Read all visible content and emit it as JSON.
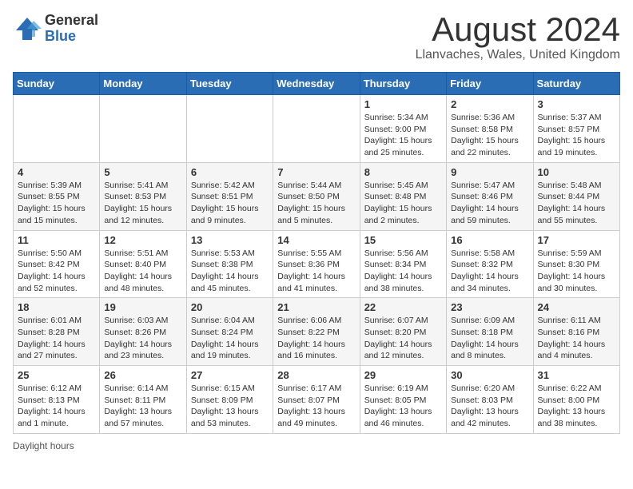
{
  "header": {
    "logo_general": "General",
    "logo_blue": "Blue",
    "month_title": "August 2024",
    "location": "Llanvaches, Wales, United Kingdom"
  },
  "weekdays": [
    "Sunday",
    "Monday",
    "Tuesday",
    "Wednesday",
    "Thursday",
    "Friday",
    "Saturday"
  ],
  "footer": {
    "daylight_label": "Daylight hours"
  },
  "weeks": [
    [
      {
        "day": "",
        "info": ""
      },
      {
        "day": "",
        "info": ""
      },
      {
        "day": "",
        "info": ""
      },
      {
        "day": "",
        "info": ""
      },
      {
        "day": "1",
        "info": "Sunrise: 5:34 AM\nSunset: 9:00 PM\nDaylight: 15 hours\nand 25 minutes."
      },
      {
        "day": "2",
        "info": "Sunrise: 5:36 AM\nSunset: 8:58 PM\nDaylight: 15 hours\nand 22 minutes."
      },
      {
        "day": "3",
        "info": "Sunrise: 5:37 AM\nSunset: 8:57 PM\nDaylight: 15 hours\nand 19 minutes."
      }
    ],
    [
      {
        "day": "4",
        "info": "Sunrise: 5:39 AM\nSunset: 8:55 PM\nDaylight: 15 hours\nand 15 minutes."
      },
      {
        "day": "5",
        "info": "Sunrise: 5:41 AM\nSunset: 8:53 PM\nDaylight: 15 hours\nand 12 minutes."
      },
      {
        "day": "6",
        "info": "Sunrise: 5:42 AM\nSunset: 8:51 PM\nDaylight: 15 hours\nand 9 minutes."
      },
      {
        "day": "7",
        "info": "Sunrise: 5:44 AM\nSunset: 8:50 PM\nDaylight: 15 hours\nand 5 minutes."
      },
      {
        "day": "8",
        "info": "Sunrise: 5:45 AM\nSunset: 8:48 PM\nDaylight: 15 hours\nand 2 minutes."
      },
      {
        "day": "9",
        "info": "Sunrise: 5:47 AM\nSunset: 8:46 PM\nDaylight: 14 hours\nand 59 minutes."
      },
      {
        "day": "10",
        "info": "Sunrise: 5:48 AM\nSunset: 8:44 PM\nDaylight: 14 hours\nand 55 minutes."
      }
    ],
    [
      {
        "day": "11",
        "info": "Sunrise: 5:50 AM\nSunset: 8:42 PM\nDaylight: 14 hours\nand 52 minutes."
      },
      {
        "day": "12",
        "info": "Sunrise: 5:51 AM\nSunset: 8:40 PM\nDaylight: 14 hours\nand 48 minutes."
      },
      {
        "day": "13",
        "info": "Sunrise: 5:53 AM\nSunset: 8:38 PM\nDaylight: 14 hours\nand 45 minutes."
      },
      {
        "day": "14",
        "info": "Sunrise: 5:55 AM\nSunset: 8:36 PM\nDaylight: 14 hours\nand 41 minutes."
      },
      {
        "day": "15",
        "info": "Sunrise: 5:56 AM\nSunset: 8:34 PM\nDaylight: 14 hours\nand 38 minutes."
      },
      {
        "day": "16",
        "info": "Sunrise: 5:58 AM\nSunset: 8:32 PM\nDaylight: 14 hours\nand 34 minutes."
      },
      {
        "day": "17",
        "info": "Sunrise: 5:59 AM\nSunset: 8:30 PM\nDaylight: 14 hours\nand 30 minutes."
      }
    ],
    [
      {
        "day": "18",
        "info": "Sunrise: 6:01 AM\nSunset: 8:28 PM\nDaylight: 14 hours\nand 27 minutes."
      },
      {
        "day": "19",
        "info": "Sunrise: 6:03 AM\nSunset: 8:26 PM\nDaylight: 14 hours\nand 23 minutes."
      },
      {
        "day": "20",
        "info": "Sunrise: 6:04 AM\nSunset: 8:24 PM\nDaylight: 14 hours\nand 19 minutes."
      },
      {
        "day": "21",
        "info": "Sunrise: 6:06 AM\nSunset: 8:22 PM\nDaylight: 14 hours\nand 16 minutes."
      },
      {
        "day": "22",
        "info": "Sunrise: 6:07 AM\nSunset: 8:20 PM\nDaylight: 14 hours\nand 12 minutes."
      },
      {
        "day": "23",
        "info": "Sunrise: 6:09 AM\nSunset: 8:18 PM\nDaylight: 14 hours\nand 8 minutes."
      },
      {
        "day": "24",
        "info": "Sunrise: 6:11 AM\nSunset: 8:16 PM\nDaylight: 14 hours\nand 4 minutes."
      }
    ],
    [
      {
        "day": "25",
        "info": "Sunrise: 6:12 AM\nSunset: 8:13 PM\nDaylight: 14 hours\nand 1 minute."
      },
      {
        "day": "26",
        "info": "Sunrise: 6:14 AM\nSunset: 8:11 PM\nDaylight: 13 hours\nand 57 minutes."
      },
      {
        "day": "27",
        "info": "Sunrise: 6:15 AM\nSunset: 8:09 PM\nDaylight: 13 hours\nand 53 minutes."
      },
      {
        "day": "28",
        "info": "Sunrise: 6:17 AM\nSunset: 8:07 PM\nDaylight: 13 hours\nand 49 minutes."
      },
      {
        "day": "29",
        "info": "Sunrise: 6:19 AM\nSunset: 8:05 PM\nDaylight: 13 hours\nand 46 minutes."
      },
      {
        "day": "30",
        "info": "Sunrise: 6:20 AM\nSunset: 8:03 PM\nDaylight: 13 hours\nand 42 minutes."
      },
      {
        "day": "31",
        "info": "Sunrise: 6:22 AM\nSunset: 8:00 PM\nDaylight: 13 hours\nand 38 minutes."
      }
    ]
  ]
}
